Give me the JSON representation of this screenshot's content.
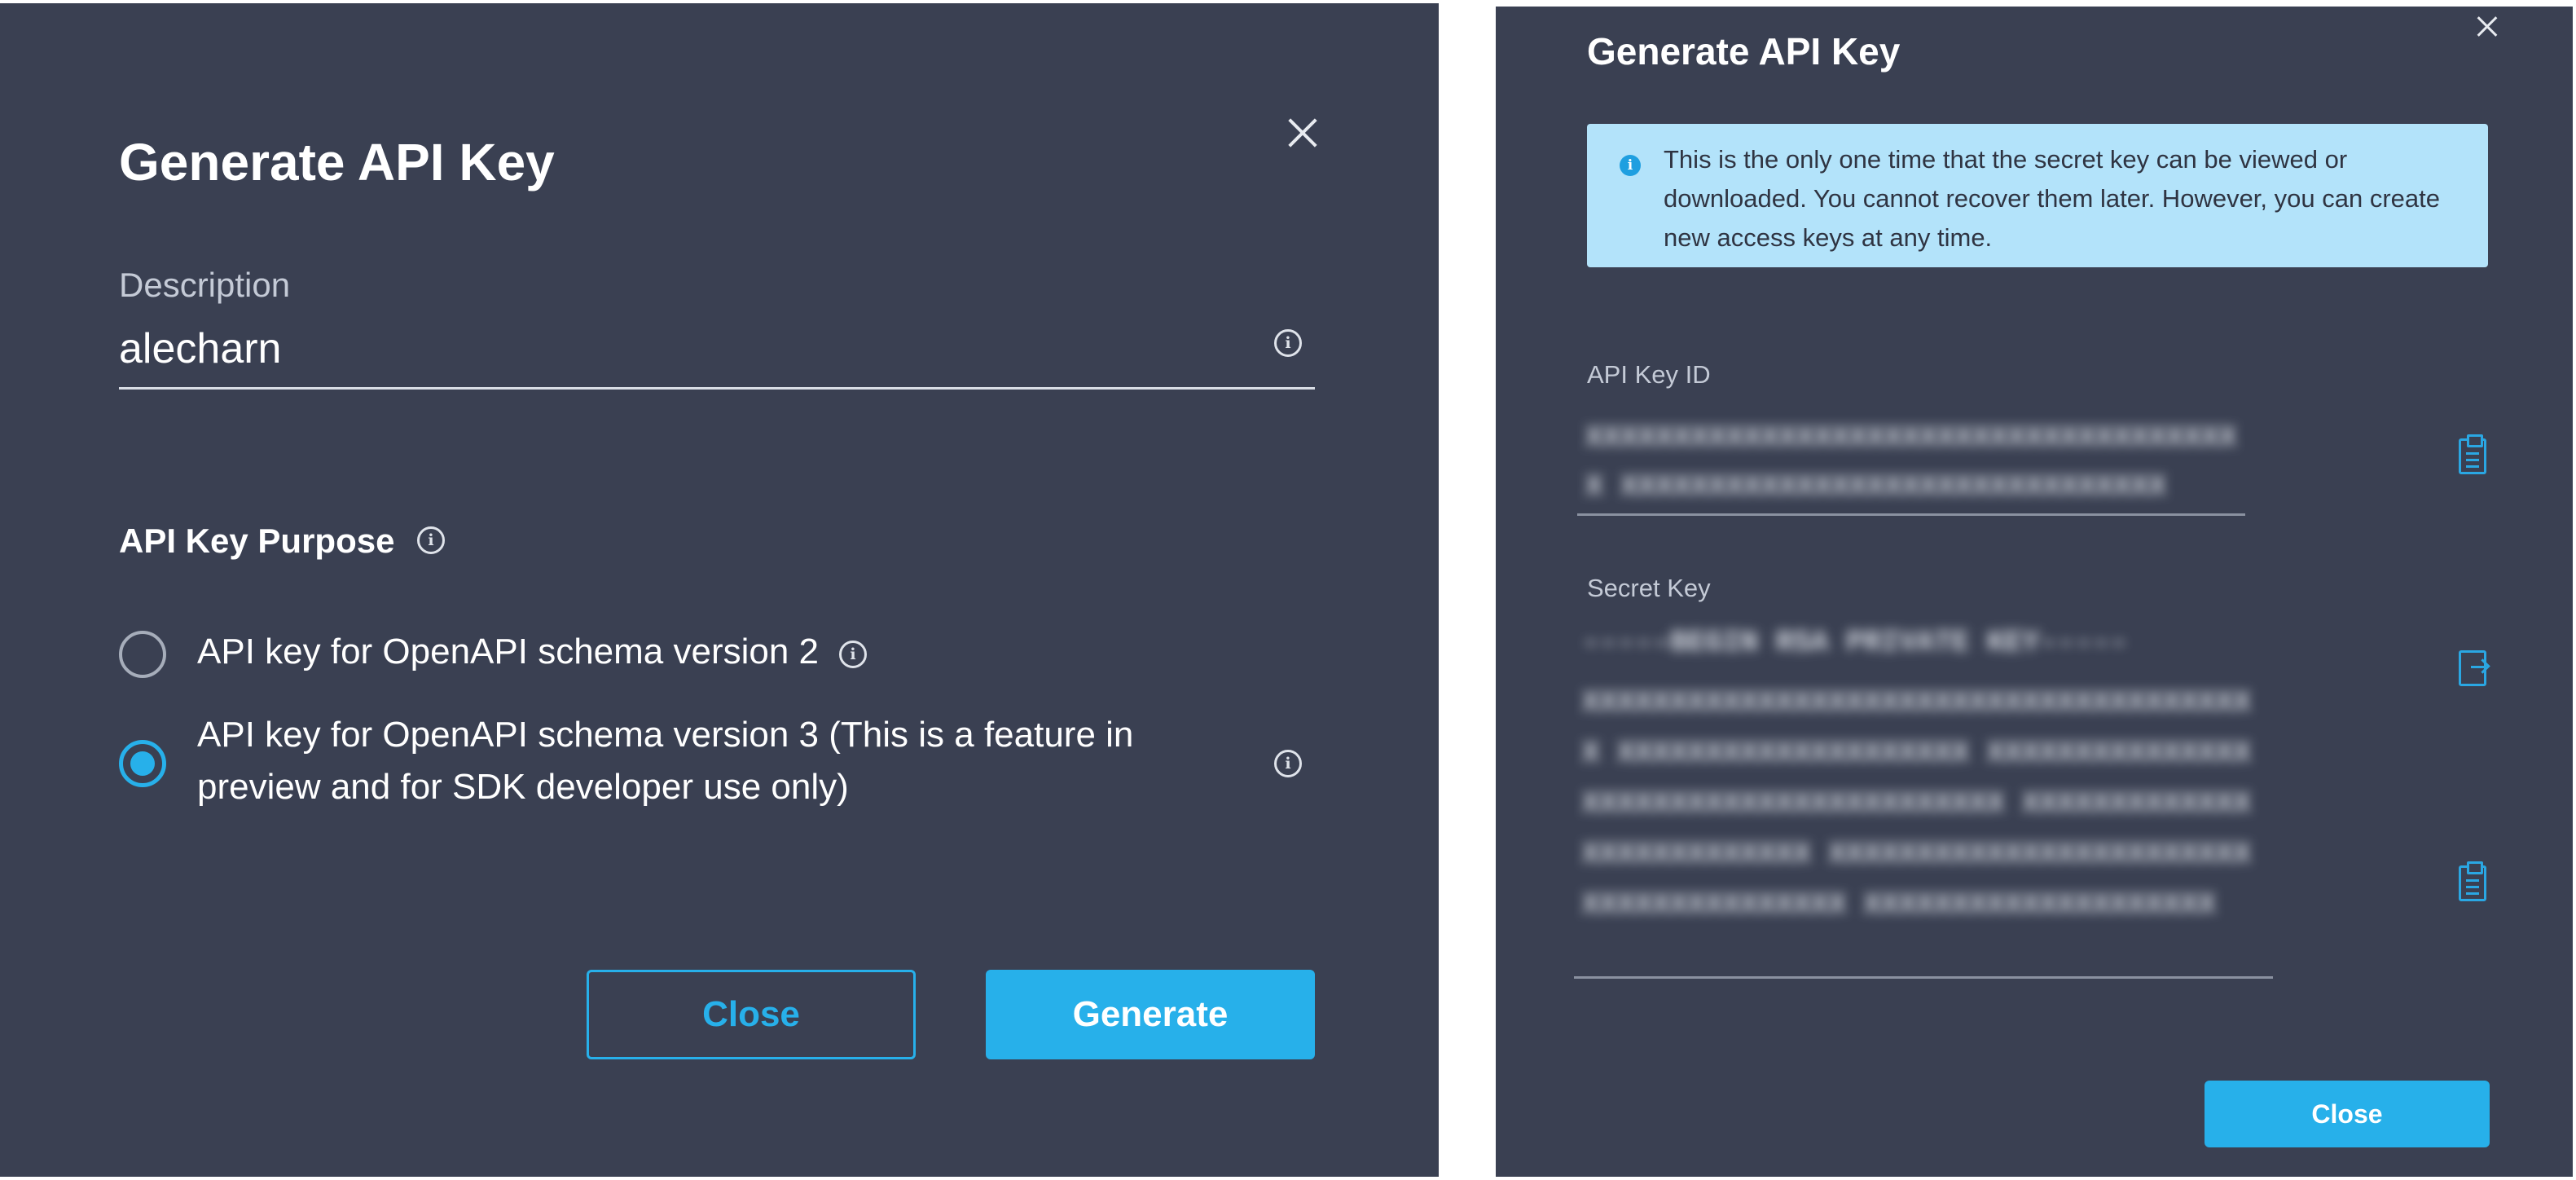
{
  "colors": {
    "dialog_bg": "#3a4052",
    "accent": "#27b0ea",
    "notice_bg": "#b3e3fa",
    "text": "#ffffff",
    "muted_text": "#c4cad6"
  },
  "left_dialog": {
    "title": "Generate API Key",
    "close_icon": "close-icon",
    "description": {
      "label": "Description",
      "value": "alecharn",
      "info_icon": "info-icon"
    },
    "purpose": {
      "label": "API Key Purpose",
      "options": [
        {
          "label": "API key for OpenAPI schema version 2",
          "selected": false
        },
        {
          "label": "API key for OpenAPI schema version 3 (This is a feature in preview and for SDK developer use only)",
          "selected": true
        }
      ]
    },
    "buttons": {
      "close": "Close",
      "generate": "Generate"
    }
  },
  "right_dialog": {
    "title": "Generate API Key",
    "notice": "This is the only one time that the secret key can be viewed or downloaded. You cannot recover them later. However, you can create new access keys at any time.",
    "api_key_id": {
      "label": "API Key ID"
    },
    "secret_key": {
      "label": "Secret Key",
      "first_line": "-----BEGIN RSA PRIVATE KEY-----"
    },
    "icons": {
      "copy_key_id": "clipboard-copy-icon",
      "download_secret": "download-icon",
      "copy_secret": "clipboard-copy-icon"
    },
    "buttons": {
      "close": "Close"
    }
  }
}
